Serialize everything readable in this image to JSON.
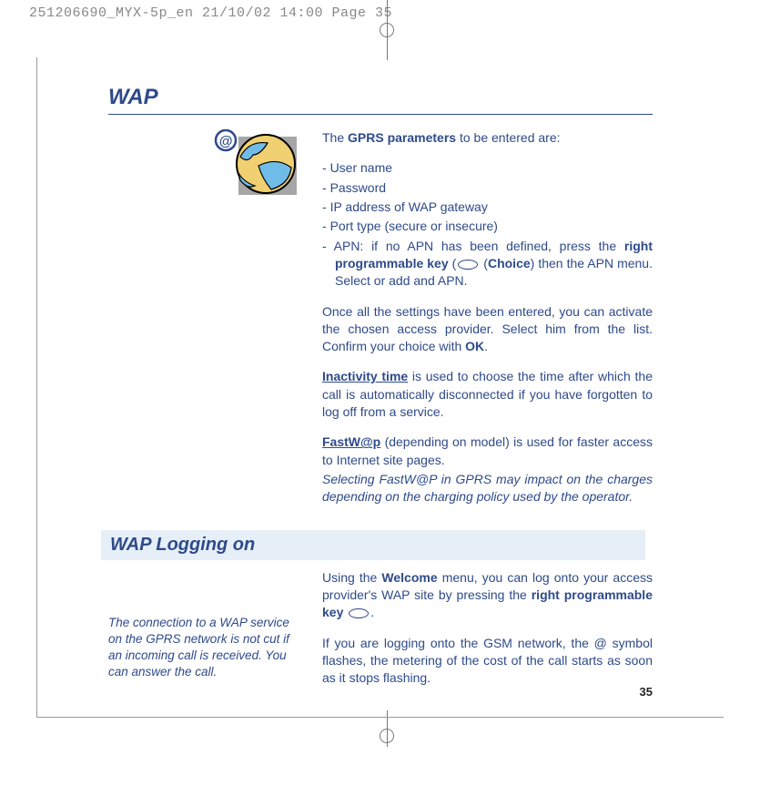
{
  "slug": "251206690_MYX-5p_en  21/10/02  14:00  Page 35",
  "title": "WAP",
  "intro_prefix": "The ",
  "intro_bold": "GPRS parameters",
  "intro_suffix": " to be entered are:",
  "params": {
    "p1": "User name",
    "p2": "Password",
    "p3": "IP address of WAP gateway",
    "p4": "Port type (secure or insecure)",
    "p5_a": "APN: if no APN has been defined, press the ",
    "p5_b": "right programmable key",
    "p5_c": " (",
    "p5_d": "Choice",
    "p5_e": ") then the APN menu. Select or add and APN."
  },
  "para_activate_a": "Once all the settings have been entered, you can activate the chosen access provider. Select him from the list. Confirm your choice with ",
  "para_activate_b": "OK",
  "para_activate_c": ".",
  "inact_label": "Inactivity time",
  "inact_text": " is used to choose the time after which the call is automatically disconnected if you have forgotten to log off from a service.",
  "fast_label": "FastW@p",
  "fast_text": " (depending on model) is used for faster access to Internet site pages.",
  "fast_note": "Selecting FastW@P in GPRS may impact on the charges depending on the charging policy used by the operator.",
  "section2": "WAP Logging on",
  "welcome_a": "Using the ",
  "welcome_b": "Welcome",
  "welcome_c": " menu, you can log onto your access provider's WAP site by pressing the ",
  "welcome_d": "right programmable key",
  "welcome_e": ".",
  "sidenote": "The connection to a WAP service on the GPRS network is not cut if an incoming call is received. You can answer the call.",
  "gsm_para": "If you are logging onto the GSM network, the @ symbol flashes, the metering of the cost of the call starts as soon as it stops flashing.",
  "pagenum": "35"
}
